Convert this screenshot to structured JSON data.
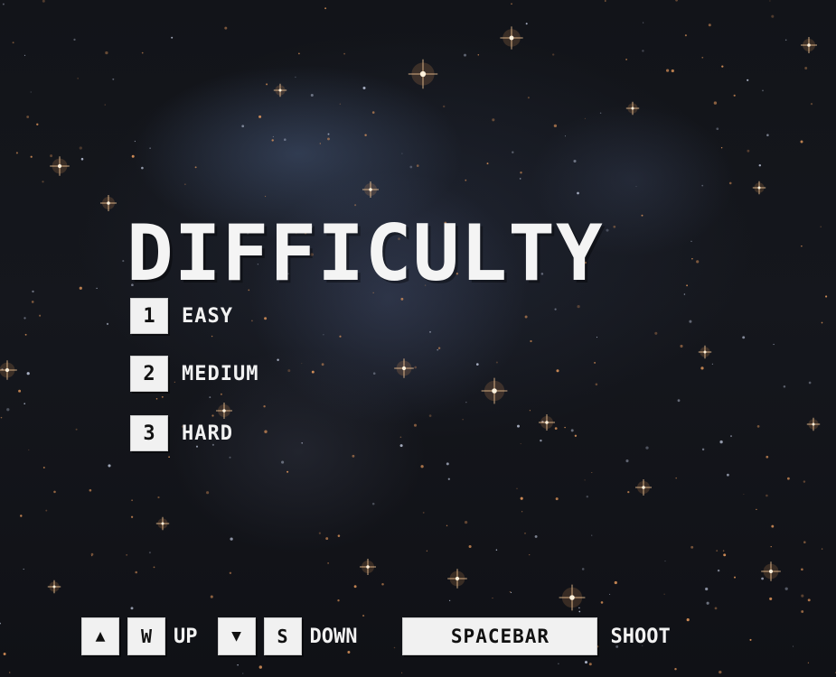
{
  "title": "DIFFICULTY",
  "menu": [
    {
      "key": "1",
      "label": "EASY"
    },
    {
      "key": "2",
      "label": "MEDIUM"
    },
    {
      "key": "3",
      "label": "HARD"
    }
  ],
  "controls": {
    "up_arrow_glyph": "▲",
    "up_key": "W",
    "up_label": "UP",
    "down_arrow_glyph": "▼",
    "down_key": "S",
    "down_label": "DOWN",
    "shoot_key": "SPACEBAR",
    "shoot_label": "SHOOT"
  },
  "colors": {
    "text": "#f2f2f2",
    "key_background": "#f1f1f1",
    "key_text": "#111111",
    "sky": "#121419",
    "star": "#f0a060"
  }
}
